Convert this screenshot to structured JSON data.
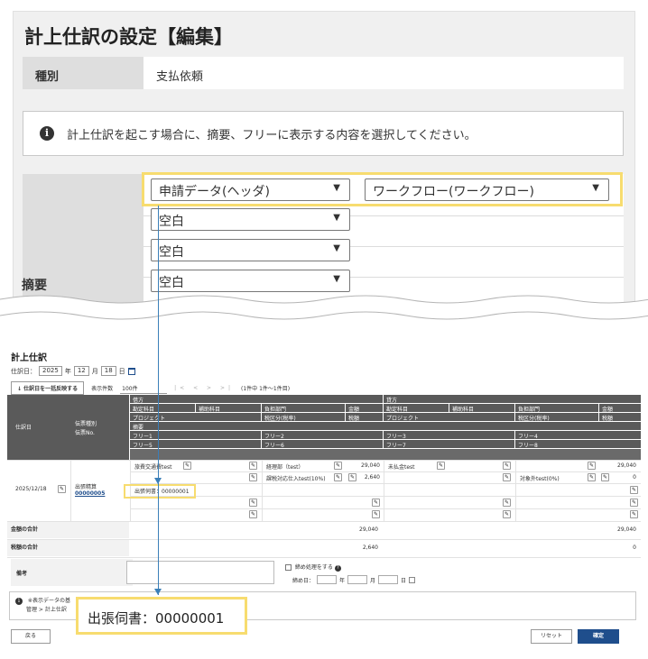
{
  "top": {
    "title": "計上仕訳の設定【編集】",
    "type_label": "種別",
    "type_value": "支払依頼",
    "info_icon": "info-circle-icon",
    "info_text": "計上仕訳を起こす場合に、摘要、フリーに表示する内容を選択してください。",
    "summary_label": "摘要",
    "selects": [
      {
        "value": "申請データ(ヘッダ)"
      },
      {
        "value": "ワークフロー(ワークフロー)"
      },
      {
        "value": "空白"
      },
      {
        "value": "空白"
      },
      {
        "value": "空白"
      }
    ],
    "caret_icon": "chevron-down-icon"
  },
  "bottom": {
    "title": "計上仕訳",
    "date_label": "仕訳日：",
    "date_year": "2025",
    "date_year_unit": "年",
    "date_month": "12",
    "date_month_unit": "月",
    "date_day": "18",
    "date_day_unit": "日",
    "bulk_button": "↓ 仕訳日を一括反映する",
    "page_size_label": "表示件数",
    "page_size": "100件",
    "pager": "|< < > >|",
    "page_info": "(1件中 1件〜1件目)",
    "headers": {
      "journal_date": "仕訳日",
      "slip_type": "伝票種別",
      "slip_no": "伝票No.",
      "debit": "借方",
      "credit": "貸方",
      "account": "勘定科目",
      "sub_account": "補助科目",
      "department": "負担部門",
      "amount": "金額",
      "project": "プロジェクト",
      "tax_class": "税区分(税率)",
      "tax_amount": "税額",
      "summary": "摘要",
      "free1": "フリー1",
      "free2": "フリー2",
      "free3": "フリー3",
      "free4": "フリー4",
      "free5": "フリー5",
      "free6": "フリー6",
      "free7": "フリー7",
      "free8": "フリー8"
    },
    "row": {
      "date": "2025/12/18",
      "slip_type": "出張精算",
      "slip_no": "00000005",
      "debit_account": "旅費交通費test",
      "debit_department": "経理部（test）",
      "debit_amount": "29,040",
      "debit_tax_class": "課税対応仕入test(10%)",
      "debit_tax": "2,640",
      "summary": "出張伺書：00000001",
      "credit_account": "未払金test",
      "credit_amount": "29,040",
      "credit_tax_class": "対象外test(0%)",
      "credit_tax": "0"
    },
    "totals": {
      "amount_label": "金額の合計",
      "debit_amount": "29,040",
      "credit_amount": "29,040",
      "tax_label": "税額の合計",
      "debit_tax": "2,640",
      "credit_tax": "0",
      "remarks_label": "備考"
    },
    "closing_check_label": "締め処理をする",
    "closing_date_label": "締め日：",
    "closing_year_unit": "年",
    "closing_month_unit": "月",
    "closing_day_unit": "日",
    "info_text_line1": "※表示データの基",
    "info_text_line2": "管理 > 計上仕訳",
    "zoom_text": "出張伺書：00000001",
    "back_button": "戻る",
    "reset_button": "リセット",
    "confirm_button": "確定"
  },
  "colors": {
    "highlight": "#f7dc6f",
    "connector": "#3b7fb8",
    "header_bg": "#5a5a5a",
    "confirm_bg": "#1f4e8c"
  }
}
